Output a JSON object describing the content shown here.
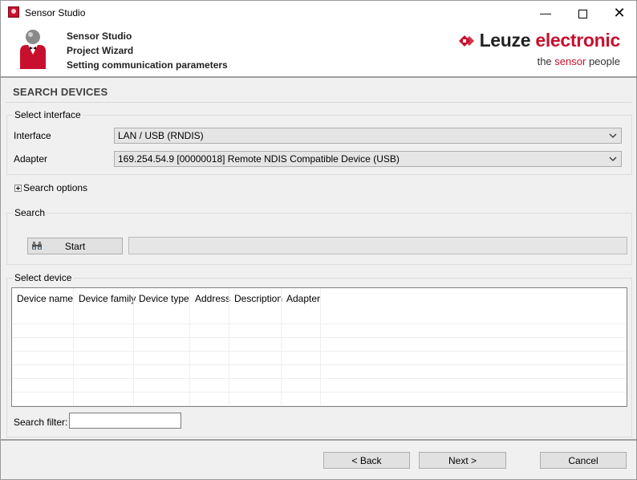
{
  "window": {
    "title": "Sensor Studio",
    "icon": "sensor-studio-app-icon"
  },
  "header": {
    "line1": "Sensor Studio",
    "line2": "Project Wizard",
    "line3": "Setting communication parameters",
    "icon": "wizard-butler-icon",
    "logo_brand": "Leuze",
    "logo_brand2": "electronic",
    "tagline_prefix": "the",
    "tagline_highlight": "sensor",
    "tagline_suffix": "people",
    "brand_color": "#c8102e"
  },
  "page_title": "SEARCH DEVICES",
  "select_interface": {
    "legend": "Select interface",
    "interface_label": "Interface",
    "interface_value": "LAN / USB (RNDIS)",
    "adapter_label": "Adapter",
    "adapter_value": "169.254.54.9 [00000018] Remote NDIS Compatible Device (USB)"
  },
  "search_options_label": "Search options",
  "search": {
    "legend": "Search",
    "start_label": "Start"
  },
  "select_device": {
    "legend": "Select device",
    "columns": [
      "Device name",
      "Device family",
      "Device type",
      "Address",
      "Description",
      "Adapter"
    ],
    "rows": []
  },
  "search_filter": {
    "label": "Search filter:",
    "value": ""
  },
  "footer": {
    "back": "< Back",
    "next": "Next >",
    "cancel": "Cancel"
  }
}
